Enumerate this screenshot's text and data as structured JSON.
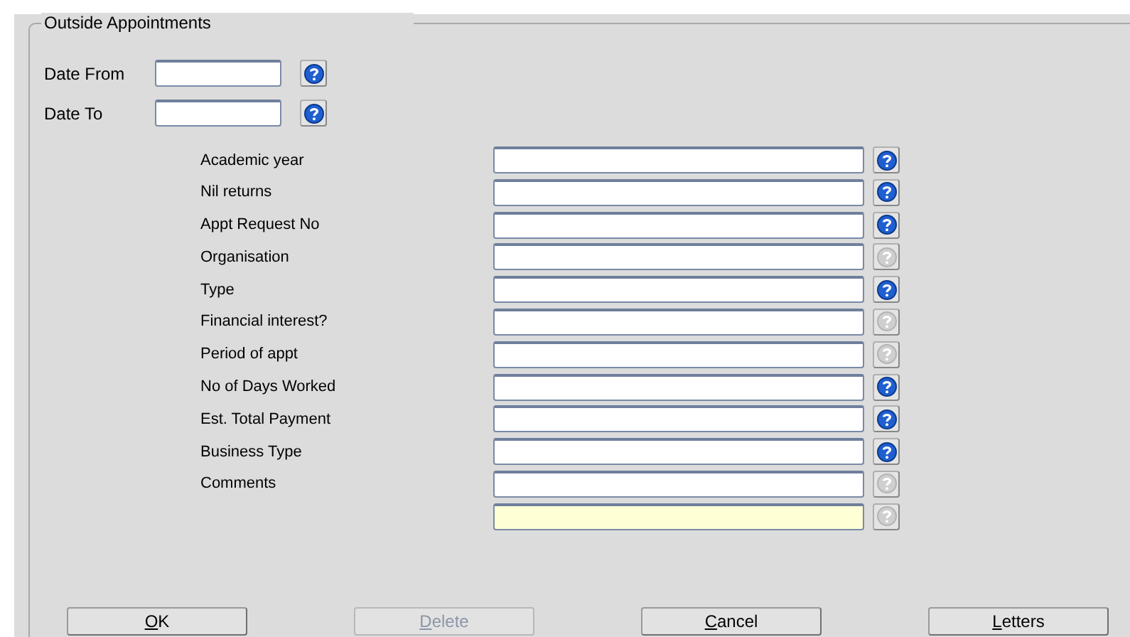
{
  "group": {
    "title": "Outside Appointments"
  },
  "date_fields": [
    {
      "label": "Date From",
      "help_enabled": true
    },
    {
      "label": "Date To",
      "help_enabled": true
    }
  ],
  "fields": [
    {
      "label": "Academic year",
      "help_enabled": true,
      "highlighted": false
    },
    {
      "label": "Nil returns",
      "help_enabled": true,
      "highlighted": false
    },
    {
      "label": "Appt Request No",
      "help_enabled": true,
      "highlighted": false
    },
    {
      "label": "Organisation",
      "help_enabled": false,
      "highlighted": false
    },
    {
      "label": "Type",
      "help_enabled": true,
      "highlighted": false
    },
    {
      "label": "Financial interest?",
      "help_enabled": false,
      "highlighted": false
    },
    {
      "label": "Period of appt",
      "help_enabled": false,
      "highlighted": false
    },
    {
      "label": "No of Days Worked",
      "help_enabled": true,
      "highlighted": false
    },
    {
      "label": "Est. Total Payment",
      "help_enabled": true,
      "highlighted": false
    },
    {
      "label": "Business Type",
      "help_enabled": true,
      "highlighted": false
    },
    {
      "label": "Comments",
      "help_enabled": false,
      "highlighted": false
    },
    {
      "help_enabled": false,
      "highlighted": true
    }
  ],
  "buttons": [
    {
      "label": "OK",
      "disabled": false
    },
    {
      "label": "Delete",
      "disabled": true
    },
    {
      "label": "Cancel",
      "disabled": false
    },
    {
      "label": "Letters",
      "disabled": false
    }
  ]
}
